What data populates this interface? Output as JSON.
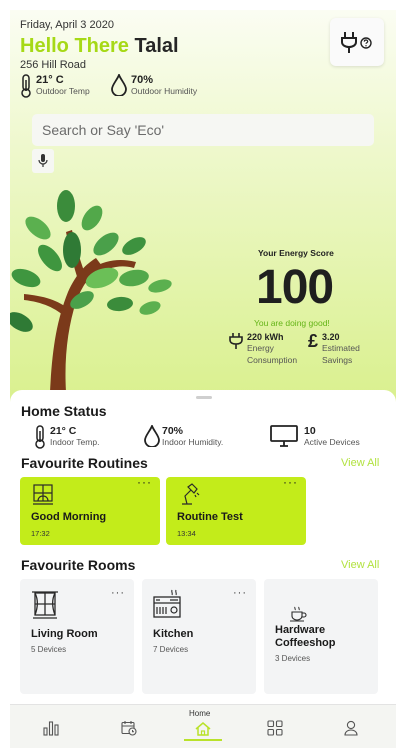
{
  "header": {
    "date": "Friday, April 3 2020",
    "greeting": "Hello There",
    "user_name": "Talal",
    "address": "256 Hill Road"
  },
  "weather": {
    "temp_value": "21° C",
    "temp_label": "Outdoor Temp",
    "humidity_value": "70%",
    "humidity_label": "Outdoor Humidity"
  },
  "search": {
    "placeholder": "Search or Say 'Eco'"
  },
  "energy": {
    "title": "Your Energy Score",
    "score": "100",
    "message": "You are doing good!",
    "consumption_value": "220 kWh",
    "consumption_label_1": "Energy",
    "consumption_label_2": "Consumption",
    "savings_value": "3.20",
    "savings_label_1": "Estimated",
    "savings_label_2": "Savings",
    "currency": "£"
  },
  "home_status": {
    "title": "Home Status",
    "temp_value": "21° C",
    "temp_label": "Indoor Temp.",
    "humidity_value": "70%",
    "humidity_label": "Indoor Humidity.",
    "devices_value": "10",
    "devices_label": "Active Devices"
  },
  "routines": {
    "title": "Favourite Routines",
    "view_all": "View All",
    "items": [
      {
        "name": "Good Morning",
        "time": "17:32",
        "menu": "···"
      },
      {
        "name": "Routine Test",
        "time": "13:34",
        "menu": "···"
      }
    ]
  },
  "rooms": {
    "title": "Favourite Rooms",
    "view_all": "View All",
    "items": [
      {
        "name": "Living Room",
        "name2": "",
        "devices": "5 Devices",
        "menu": "···"
      },
      {
        "name": "Kitchen",
        "name2": "",
        "devices": "7 Devices",
        "menu": "···"
      },
      {
        "name": "Hardware",
        "name2": "Coffeeshop",
        "devices": "3 Devices",
        "menu": ""
      }
    ]
  },
  "nav": {
    "home_label": "Home"
  },
  "colors": {
    "accent": "#c3ec1a",
    "brand_green": "#a6d916",
    "view_all": "#b2e240"
  }
}
